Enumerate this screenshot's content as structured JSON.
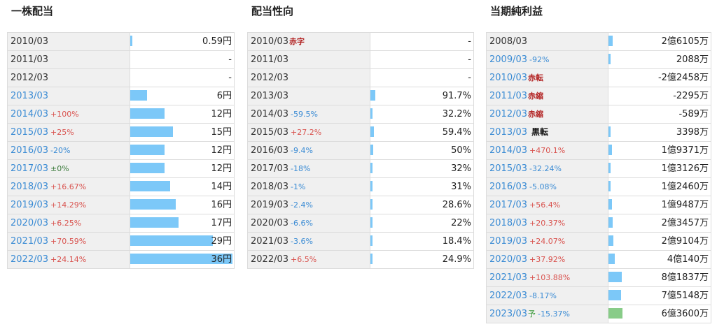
{
  "panels": [
    {
      "title": "一株配当",
      "bar_color": "#7cc8f8",
      "rows": [
        {
          "year": "2010/03",
          "change": "",
          "dir": "",
          "tag": "",
          "value": "0.59円",
          "bar": 0.0098
        },
        {
          "year": "2011/03",
          "change": "",
          "dir": "",
          "tag": "",
          "value": "-",
          "bar": 0
        },
        {
          "year": "2012/03",
          "change": "",
          "dir": "",
          "tag": "",
          "value": "-",
          "bar": 0
        },
        {
          "year": "2013/03",
          "change": "",
          "dir": "",
          "tag": "",
          "value": "6円",
          "bar": 0.167,
          "link": true
        },
        {
          "year": "2014/03",
          "change": "+100%",
          "dir": "up",
          "tag": "",
          "value": "12円",
          "bar": 0.333,
          "link": true
        },
        {
          "year": "2015/03",
          "change": "+25%",
          "dir": "up",
          "tag": "",
          "value": "15円",
          "bar": 0.417,
          "link": true
        },
        {
          "year": "2016/03",
          "change": "-20%",
          "dir": "down",
          "tag": "",
          "value": "12円",
          "bar": 0.333,
          "link": true
        },
        {
          "year": "2017/03",
          "change": "±0%",
          "dir": "flat",
          "tag": "",
          "value": "12円",
          "bar": 0.333,
          "link": true
        },
        {
          "year": "2018/03",
          "change": "+16.67%",
          "dir": "up",
          "tag": "",
          "value": "14円",
          "bar": 0.389,
          "link": true
        },
        {
          "year": "2019/03",
          "change": "+14.29%",
          "dir": "up",
          "tag": "",
          "value": "16円",
          "bar": 0.444,
          "link": true
        },
        {
          "year": "2020/03",
          "change": "+6.25%",
          "dir": "up",
          "tag": "",
          "value": "17円",
          "bar": 0.472,
          "link": true
        },
        {
          "year": "2021/03",
          "change": "+70.59%",
          "dir": "up",
          "tag": "",
          "value": "29円",
          "bar": 0.806,
          "link": true
        },
        {
          "year": "2022/03",
          "change": "+24.14%",
          "dir": "up",
          "tag": "",
          "value": "36円",
          "bar": 1.0,
          "link": true
        }
      ]
    },
    {
      "title": "配当性向",
      "bar_color": "#7cc8f8",
      "rows": [
        {
          "year": "2010/03",
          "change": "",
          "dir": "",
          "tag": "赤字",
          "tagcls": "red",
          "value": "-",
          "bar": 0
        },
        {
          "year": "2011/03",
          "change": "",
          "dir": "",
          "tag": "",
          "value": "-",
          "bar": 0
        },
        {
          "year": "2012/03",
          "change": "",
          "dir": "",
          "tag": "",
          "value": "-",
          "bar": 0
        },
        {
          "year": "2013/03",
          "change": "",
          "dir": "",
          "tag": "",
          "value": "91.7%",
          "bar": 0.917
        },
        {
          "year": "2014/03",
          "change": "-59.5%",
          "dir": "down",
          "tag": "",
          "value": "32.2%",
          "bar": 0.322
        },
        {
          "year": "2015/03",
          "change": "+27.2%",
          "dir": "up",
          "tag": "",
          "value": "59.4%",
          "bar": 0.594
        },
        {
          "year": "2016/03",
          "change": "-9.4%",
          "dir": "down",
          "tag": "",
          "value": "50%",
          "bar": 0.5
        },
        {
          "year": "2017/03",
          "change": "-18%",
          "dir": "down",
          "tag": "",
          "value": "32%",
          "bar": 0.32
        },
        {
          "year": "2018/03",
          "change": "-1%",
          "dir": "down",
          "tag": "",
          "value": "31%",
          "bar": 0.31
        },
        {
          "year": "2019/03",
          "change": "-2.4%",
          "dir": "down",
          "tag": "",
          "value": "28.6%",
          "bar": 0.286
        },
        {
          "year": "2020/03",
          "change": "-6.6%",
          "dir": "down",
          "tag": "",
          "value": "22%",
          "bar": 0.22
        },
        {
          "year": "2021/03",
          "change": "-3.6%",
          "dir": "down",
          "tag": "",
          "value": "18.4%",
          "bar": 0.184
        },
        {
          "year": "2022/03",
          "change": "+6.5%",
          "dir": "up",
          "tag": "",
          "value": "24.9%",
          "bar": 0.249
        }
      ]
    },
    {
      "title": "当期純利益",
      "bar_color": "#7cc8f8",
      "rows": [
        {
          "year": "2008/03",
          "change": "",
          "dir": "",
          "tag": "",
          "value": "2億6105万",
          "bar": 0.0307
        },
        {
          "year": "2009/03",
          "change": "-92%",
          "dir": "down",
          "tag": "",
          "value": "2088万",
          "bar": 0.0025,
          "link": true
        },
        {
          "year": "2010/03",
          "change": "",
          "dir": "",
          "tag": "赤転",
          "tagcls": "red",
          "value": "-2億2458万",
          "bar": 0,
          "link": true
        },
        {
          "year": "2011/03",
          "change": "",
          "dir": "",
          "tag": "赤縮",
          "tagcls": "red",
          "value": "-2295万",
          "bar": 0,
          "link": true
        },
        {
          "year": "2012/03",
          "change": "",
          "dir": "",
          "tag": "赤縮",
          "tagcls": "red",
          "value": "-589万",
          "bar": 0,
          "link": true
        },
        {
          "year": "2013/03",
          "change": "",
          "dir": "",
          "tag": "黒転",
          "tagcls": "black",
          "value": "3398万",
          "bar": 0.004,
          "link": true
        },
        {
          "year": "2014/03",
          "change": "+470.1%",
          "dir": "up",
          "tag": "",
          "value": "1億9371万",
          "bar": 0.0228,
          "link": true
        },
        {
          "year": "2015/03",
          "change": "-32.24%",
          "dir": "down",
          "tag": "",
          "value": "1億3126万",
          "bar": 0.0154,
          "link": true
        },
        {
          "year": "2016/03",
          "change": "-5.08%",
          "dir": "down",
          "tag": "",
          "value": "1億2460万",
          "bar": 0.0146,
          "link": true
        },
        {
          "year": "2017/03",
          "change": "+56.4%",
          "dir": "up",
          "tag": "",
          "value": "1億9487万",
          "bar": 0.0229,
          "link": true
        },
        {
          "year": "2018/03",
          "change": "+20.37%",
          "dir": "up",
          "tag": "",
          "value": "2億3457万",
          "bar": 0.0276,
          "link": true
        },
        {
          "year": "2019/03",
          "change": "+24.07%",
          "dir": "up",
          "tag": "",
          "value": "2億9104万",
          "bar": 0.0342,
          "link": true
        },
        {
          "year": "2020/03",
          "change": "+37.92%",
          "dir": "up",
          "tag": "",
          "value": "4億140万",
          "bar": 0.0472,
          "link": true
        },
        {
          "year": "2021/03",
          "change": "+103.88%",
          "dir": "up",
          "tag": "",
          "value": "8億1837万",
          "bar": 0.0962,
          "link": true
        },
        {
          "year": "2022/03",
          "change": "-8.17%",
          "dir": "down",
          "tag": "",
          "value": "7億5148万",
          "bar": 0.0884,
          "link": true
        },
        {
          "year": "2023/03",
          "change": "-15.37%",
          "dir": "down",
          "tag": "予",
          "tagcls": "green",
          "value": "6億3600万",
          "bar": 0.1,
          "green": true,
          "link": true
        }
      ]
    }
  ]
}
